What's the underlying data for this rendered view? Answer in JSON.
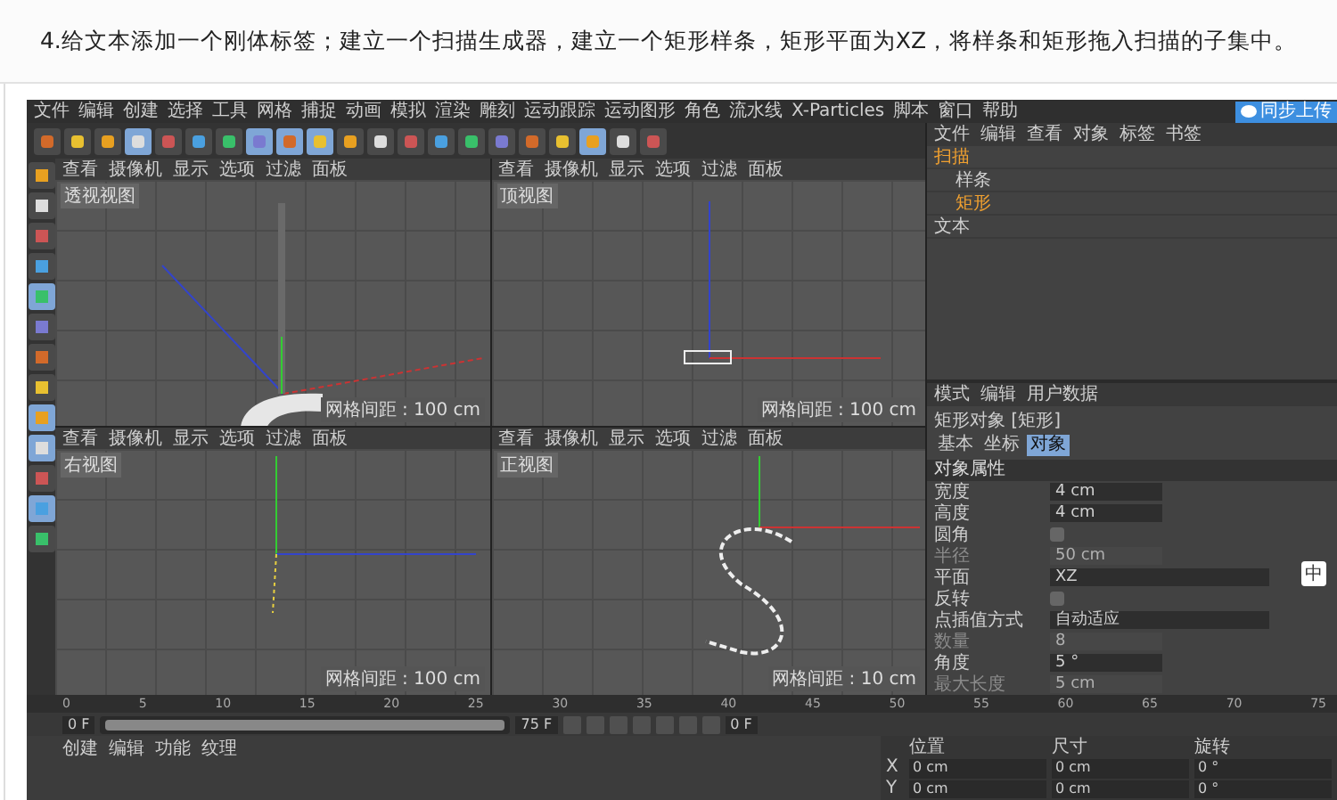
{
  "heading": "4.给文本添加一个刚体标签；建立一个扫描生成器，建立一个矩形样条，矩形平面为XZ，将样条和矩形拖入扫描的子集中。",
  "app": {
    "menu": [
      "文件",
      "编辑",
      "创建",
      "选择",
      "工具",
      "网格",
      "捕捉",
      "动画",
      "模拟",
      "渲染",
      "雕刻",
      "运动跟踪",
      "运动图形",
      "角色",
      "流水线",
      "X-Particles",
      "脚本",
      "窗口",
      "帮助"
    ],
    "upload_button": "同步上传",
    "toolbar": [
      {
        "selected": false
      },
      {
        "selected": false
      },
      {
        "selected": false
      },
      {
        "selected": true
      },
      {
        "selected": false
      },
      {
        "selected": false
      },
      {
        "selected": false
      },
      {
        "selected": true
      },
      {
        "selected": true
      },
      {
        "selected": true
      },
      {
        "selected": false
      },
      {
        "selected": false
      },
      {
        "selected": false
      },
      {
        "selected": false
      },
      {
        "selected": false
      },
      {
        "selected": false
      },
      {
        "selected": false
      },
      {
        "selected": false
      },
      {
        "selected": true
      },
      {
        "selected": false
      },
      {
        "selected": false
      }
    ],
    "side_tools": [
      {
        "selected": false
      },
      {
        "selected": false
      },
      {
        "selected": false
      },
      {
        "selected": false
      },
      {
        "selected": true
      },
      {
        "selected": false
      },
      {
        "selected": false
      },
      {
        "selected": false
      },
      {
        "selected": true
      },
      {
        "selected": true
      },
      {
        "selected": false
      },
      {
        "selected": true
      },
      {
        "selected": false
      }
    ],
    "viewports": [
      {
        "kind": "perspective",
        "label": "透视视图",
        "menu": [
          "查看",
          "摄像机",
          "显示",
          "选项",
          "过滤",
          "面板"
        ],
        "grid_spacing": "网格间距 : 100 cm"
      },
      {
        "kind": "top",
        "label": "顶视图",
        "menu": [
          "查看",
          "摄像机",
          "显示",
          "选项",
          "过滤",
          "面板"
        ],
        "grid_spacing": "网格间距 : 100 cm"
      },
      {
        "kind": "right",
        "label": "右视图",
        "menu": [
          "查看",
          "摄像机",
          "显示",
          "选项",
          "过滤",
          "面板"
        ],
        "grid_spacing": "网格间距 : 100 cm"
      },
      {
        "kind": "front",
        "label": "正视图",
        "menu": [
          "查看",
          "摄像机",
          "显示",
          "选项",
          "过滤",
          "面板"
        ],
        "grid_spacing": "网格间距 : 10 cm"
      }
    ],
    "objects": {
      "menu": [
        "文件",
        "编辑",
        "查看",
        "对象",
        "标签",
        "书签"
      ],
      "tree": [
        {
          "name": "扫描",
          "selected": true,
          "children": [
            {
              "name": "样条",
              "selected": false
            },
            {
              "name": "矩形",
              "selected": true
            }
          ]
        },
        {
          "name": "文本",
          "selected": false
        }
      ]
    },
    "attributes": {
      "menu": [
        "模式",
        "编辑",
        "用户数据"
      ],
      "title": "矩形对象 [矩形]",
      "tabs": [
        {
          "label": "基本",
          "selected": false
        },
        {
          "label": "坐标",
          "selected": false
        },
        {
          "label": "对象",
          "selected": true
        }
      ],
      "section": "对象属性",
      "fields": [
        {
          "kind": "number",
          "label": "宽度",
          "value": "4 cm",
          "disabled": false
        },
        {
          "kind": "number",
          "label": "高度",
          "value": "4 cm",
          "disabled": false
        },
        {
          "kind": "check",
          "label": "圆角",
          "checked": false,
          "disabled": false
        },
        {
          "kind": "number",
          "label": "半径",
          "value": "50 cm",
          "disabled": true
        },
        {
          "kind": "dropdown",
          "label": "平面",
          "value": "XZ",
          "disabled": false
        },
        {
          "kind": "check",
          "label": "反转",
          "checked": false,
          "disabled": false
        },
        {
          "kind": "dropdown",
          "label": "点插值方式",
          "value": "自动适应",
          "disabled": false
        },
        {
          "kind": "number",
          "label": "数量",
          "value": "8",
          "disabled": true
        },
        {
          "kind": "number",
          "label": "角度",
          "value": "5 °",
          "disabled": false
        },
        {
          "kind": "number",
          "label": "最大长度",
          "value": "5 cm",
          "disabled": true
        }
      ]
    },
    "ime": "中",
    "timeline": {
      "ticks": [
        "0",
        "5",
        "10",
        "15",
        "20",
        "25",
        "30",
        "35",
        "40",
        "45",
        "50",
        "55",
        "60",
        "65",
        "70",
        "75"
      ],
      "current": "0 F",
      "start": "0 F",
      "end": "75 F",
      "level": 1
    },
    "materials": {
      "menu": [
        "创建",
        "编辑",
        "功能",
        "纹理"
      ]
    },
    "coords": {
      "headers": [
        "位置",
        "尺寸",
        "旋转"
      ],
      "rows": [
        {
          "axis": "X",
          "values": [
            "0 cm",
            "0 cm",
            "0 °"
          ]
        },
        {
          "axis": "Y",
          "values": [
            "0 cm",
            "0 cm",
            "0 °"
          ]
        }
      ]
    }
  }
}
